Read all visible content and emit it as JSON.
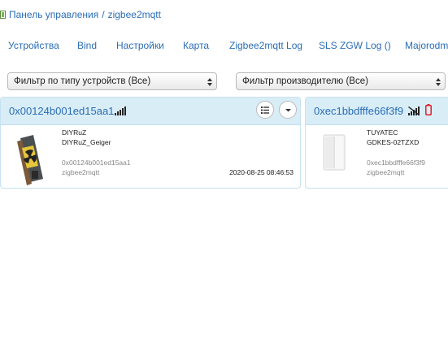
{
  "breadcrumb": {
    "home": "Панель управления",
    "separator": "/",
    "current": "zigbee2mqtt"
  },
  "tabs": [
    "Устройства",
    "Bind",
    "Настройки",
    "Карта",
    "Zigbee2mqtt Log",
    "SLS ZGW Log ()",
    "Majorodmo"
  ],
  "filters": {
    "type": "Фильтр по типу устройств (Все)",
    "manufacturer": "Фильтр производителю (Все)"
  },
  "devices": [
    {
      "id": "0x00124b001ed15aa1",
      "manufacturer": "DIYRuZ",
      "model": "DIYRuZ_Geiger",
      "ieee": "0x00124b001ed15aa1",
      "source": "zigbee2mqtt",
      "last_seen": "2020-08-25 08:46:53",
      "signal_icon": "signal-bars-icon"
    },
    {
      "id": "0xec1bbdfffe66f3f9",
      "manufacturer": "TUYATEC",
      "model": "GDKES-02TZXD",
      "ieee": "0xec1bbdfffe66f3f9",
      "source": "zigbee2mqtt",
      "signal_icon": "no-signal-icon",
      "battery_icon": "battery-empty-icon",
      "status_color": "#e0202a"
    }
  ]
}
